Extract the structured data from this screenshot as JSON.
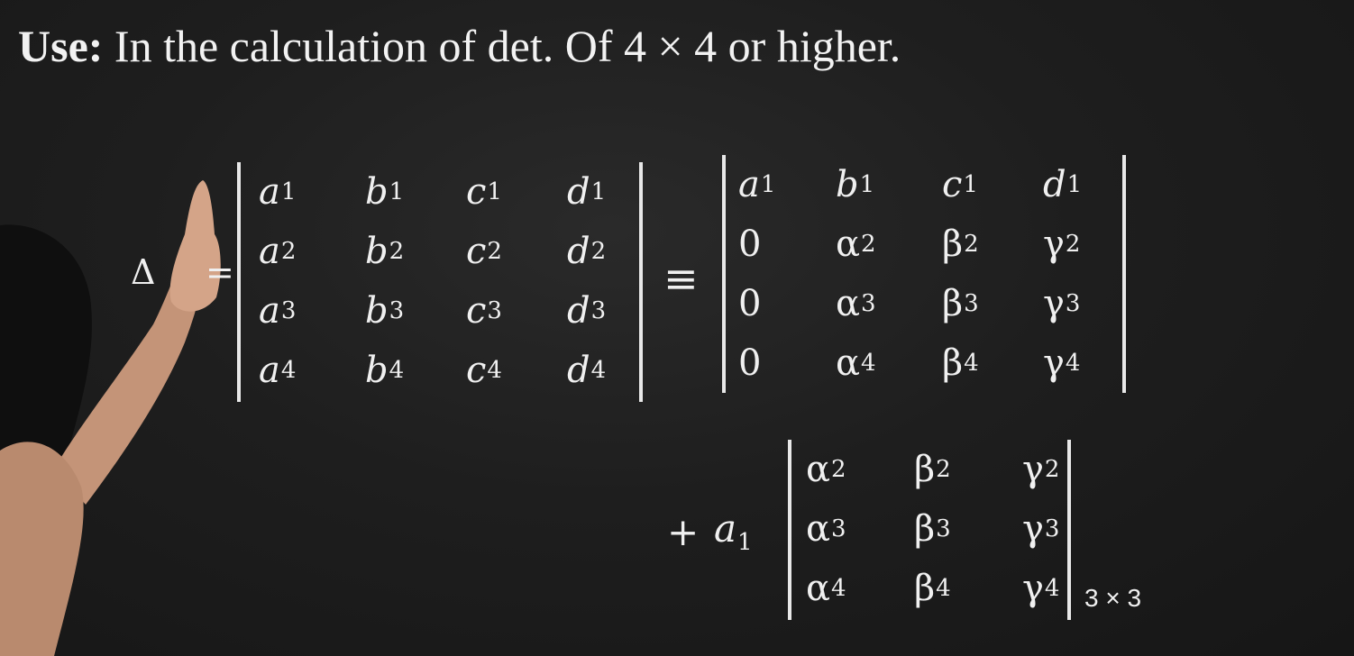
{
  "heading": {
    "label": "Use:",
    "text": "In the calculation of det. Of 4 × 4 or higher."
  },
  "lhs": {
    "symbol": "Δ",
    "equals": "="
  },
  "det4a": [
    [
      [
        "a",
        "1"
      ],
      [
        "b",
        "1"
      ],
      [
        "c",
        "1"
      ],
      [
        "d",
        "1"
      ]
    ],
    [
      [
        "a",
        "2"
      ],
      [
        "b",
        "2"
      ],
      [
        "c",
        "2"
      ],
      [
        "d",
        "2"
      ]
    ],
    [
      [
        "a",
        "3"
      ],
      [
        "b",
        "3"
      ],
      [
        "c",
        "3"
      ],
      [
        "d",
        "3"
      ]
    ],
    [
      [
        "a",
        "4"
      ],
      [
        "b",
        "4"
      ],
      [
        "c",
        "4"
      ],
      [
        "d",
        "4"
      ]
    ]
  ],
  "equiv": "≡",
  "det4b": [
    [
      [
        "a",
        "1"
      ],
      [
        "b",
        "1"
      ],
      [
        "c",
        "1"
      ],
      [
        "d",
        "1"
      ]
    ],
    [
      [
        "0",
        ""
      ],
      [
        "α",
        "2"
      ],
      [
        "β",
        "2"
      ],
      [
        "γ",
        "2"
      ]
    ],
    [
      [
        "0",
        ""
      ],
      [
        "α",
        "3"
      ],
      [
        "β",
        "3"
      ],
      [
        "γ",
        "3"
      ]
    ],
    [
      [
        "0",
        ""
      ],
      [
        "α",
        "4"
      ],
      [
        "β",
        "4"
      ],
      [
        "γ",
        "4"
      ]
    ]
  ],
  "expansion": {
    "prefix": "+",
    "coef_base": "a",
    "coef_sub": "1",
    "order_label": "3 × 3"
  },
  "det3": [
    [
      [
        "α",
        "2"
      ],
      [
        "β",
        "2"
      ],
      [
        "γ",
        "2"
      ]
    ],
    [
      [
        "α",
        "3"
      ],
      [
        "β",
        "3"
      ],
      [
        "γ",
        "3"
      ]
    ],
    [
      [
        "α",
        "4"
      ],
      [
        "β",
        "4"
      ],
      [
        "γ",
        "4"
      ]
    ]
  ]
}
